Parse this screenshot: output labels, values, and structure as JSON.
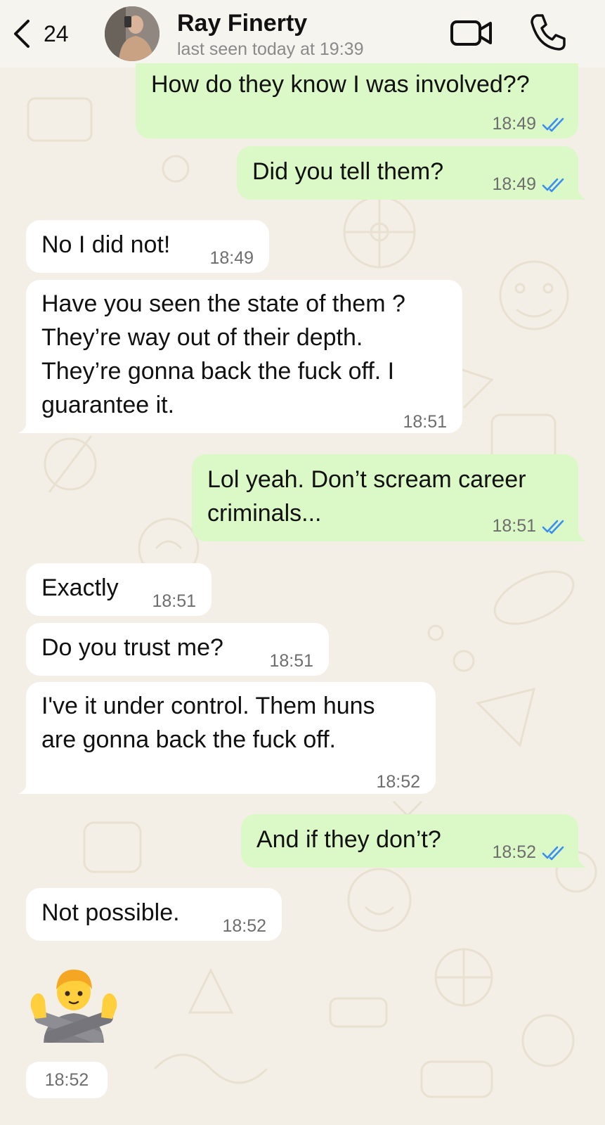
{
  "header": {
    "back_count": "24",
    "contact_name": "Ray Finerty",
    "last_seen": "last seen today at 19:39"
  },
  "messages": [
    {
      "direction": "outgoing",
      "text": [
        "How do they know I was involved??"
      ],
      "time": "18:49",
      "read": true
    },
    {
      "direction": "outgoing",
      "text": [
        "Did you tell them?"
      ],
      "time": "18:49",
      "read": true
    },
    {
      "direction": "incoming",
      "text": [
        "No I did not!"
      ],
      "time": "18:49"
    },
    {
      "direction": "incoming",
      "text": [
        "Have you seen the state of them ?",
        "They’re way out of their depth.",
        "They’re gonna back the fuck off. I",
        "guarantee it."
      ],
      "time": "18:51"
    },
    {
      "direction": "outgoing",
      "text": [
        "Lol yeah. Don’t scream career",
        "criminals..."
      ],
      "time": "18:51",
      "read": true
    },
    {
      "direction": "incoming",
      "text": [
        "Exactly"
      ],
      "time": "18:51"
    },
    {
      "direction": "incoming",
      "text": [
        "Do you trust me?"
      ],
      "time": "18:51"
    },
    {
      "direction": "incoming",
      "text": [
        "I've it under control. Them huns",
        "are gonna back the fuck off."
      ],
      "time": "18:52"
    },
    {
      "direction": "outgoing",
      "text": [
        "And if they don’t?"
      ],
      "time": "18:52",
      "read": true
    },
    {
      "direction": "incoming",
      "text": [
        "Not possible."
      ],
      "time": "18:52"
    }
  ],
  "emoji_message": {
    "emoji": "person-gesturing-no",
    "time": "18:52"
  },
  "colors": {
    "outgoing_bubble": "#dbf8c7",
    "incoming_bubble": "#ffffff",
    "read_ticks": "#3b8df2",
    "wallpaper": "#f4efe6"
  }
}
